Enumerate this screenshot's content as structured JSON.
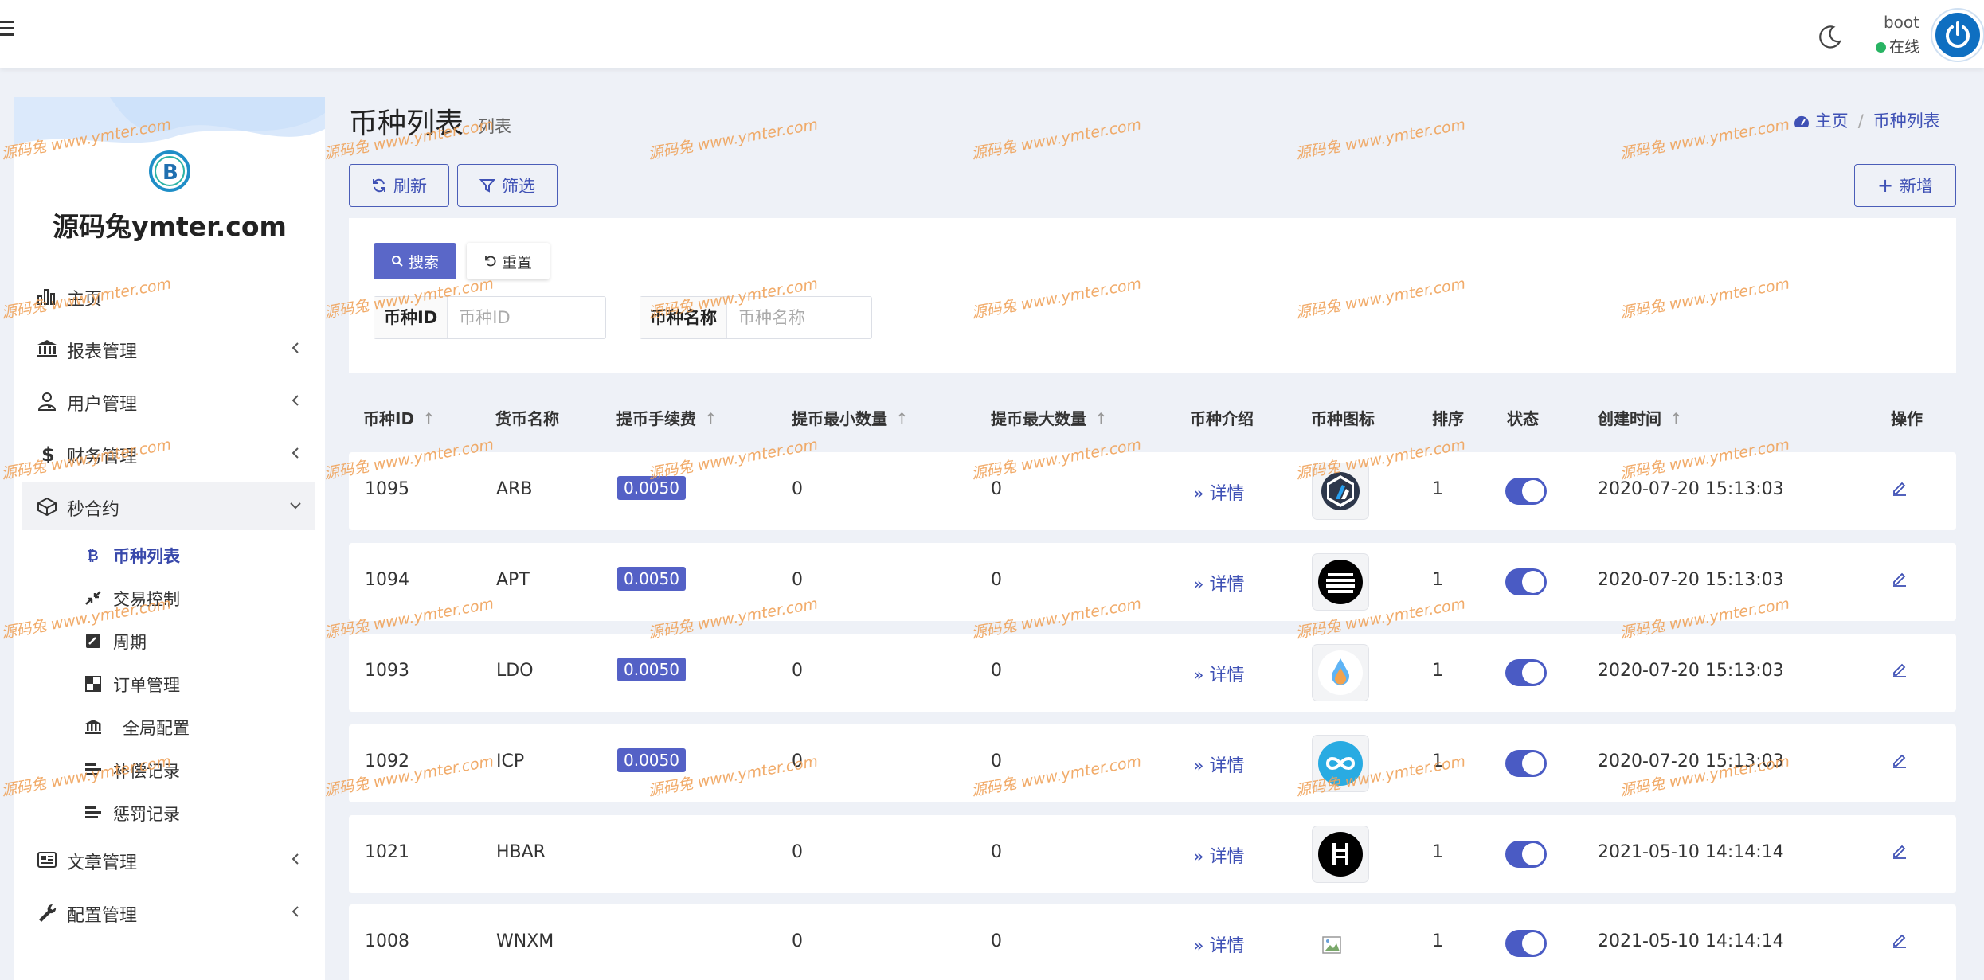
{
  "header": {
    "user_name": "boot",
    "user_status": "在线"
  },
  "sidebar": {
    "brand": "源码兔ymter.com",
    "items": [
      {
        "label": "主页",
        "icon": "bar-chart-icon"
      },
      {
        "label": "报表管理",
        "icon": "bank-icon"
      },
      {
        "label": "用户管理",
        "icon": "user-doctor-icon"
      },
      {
        "label": "财务管理",
        "icon": "dollar-icon"
      },
      {
        "label": "秒合约",
        "icon": "cube-icon"
      },
      {
        "label": "文章管理",
        "icon": "newspaper-icon"
      },
      {
        "label": "配置管理",
        "icon": "wrench-icon"
      }
    ],
    "sub_items": [
      {
        "label": "币种列表",
        "icon": "bitcoin-icon"
      },
      {
        "label": "交易控制",
        "icon": "compress-icon"
      },
      {
        "label": "周期",
        "icon": "edit-square-icon"
      },
      {
        "label": "订单管理",
        "icon": "chess-board-icon"
      },
      {
        "label": "全局配置",
        "icon": "bank-icon"
      },
      {
        "label": "补偿记录",
        "icon": "align-left-icon"
      },
      {
        "label": "惩罚记录",
        "icon": "align-left-icon"
      }
    ]
  },
  "page": {
    "title": "币种列表",
    "subtitle": "列表",
    "breadcrumb": {
      "home": "主页",
      "current": "币种列表"
    },
    "refresh_label": "刷新",
    "filter_label": "筛选",
    "add_label": "新增"
  },
  "search": {
    "search_label": "搜索",
    "reset_label": "重置",
    "id_label": "币种ID",
    "id_placeholder": "币种ID",
    "name_label": "币种名称",
    "name_placeholder": "币种名称"
  },
  "table": {
    "headers": [
      "币种ID",
      "货币名称",
      "提币手续费",
      "提币最小数量",
      "提币最大数量",
      "币种介绍",
      "币种图标",
      "排序",
      "状态",
      "创建时间",
      "操作"
    ],
    "sort_glyph": "↑",
    "detail_label": "详情",
    "rows": [
      {
        "id": "1095",
        "name": "ARB",
        "fee": "0.0050",
        "min": "0",
        "max": "0",
        "icon": "arbitrum-icon",
        "sort": "1",
        "status": true,
        "created": "2020-07-20 15:13:03"
      },
      {
        "id": "1094",
        "name": "APT",
        "fee": "0.0050",
        "min": "0",
        "max": "0",
        "icon": "aptos-icon",
        "sort": "1",
        "status": true,
        "created": "2020-07-20 15:13:03"
      },
      {
        "id": "1093",
        "name": "LDO",
        "fee": "0.0050",
        "min": "0",
        "max": "0",
        "icon": "lido-icon",
        "sort": "1",
        "status": true,
        "created": "2020-07-20 15:13:03"
      },
      {
        "id": "1092",
        "name": "ICP",
        "fee": "0.0050",
        "min": "0",
        "max": "0",
        "icon": "icp-icon",
        "sort": "1",
        "status": true,
        "created": "2020-07-20 15:13:03"
      },
      {
        "id": "1021",
        "name": "HBAR",
        "fee": "",
        "min": "0",
        "max": "0",
        "icon": "hedera-icon",
        "sort": "1",
        "status": true,
        "created": "2021-05-10 14:14:14"
      },
      {
        "id": "1008",
        "name": "WNXM",
        "fee": "",
        "min": "0",
        "max": "0",
        "icon": "broken-image-icon",
        "sort": "1",
        "status": true,
        "created": "2021-05-10 14:14:14"
      }
    ]
  },
  "watermark": "源码兔 www.ymter.com",
  "colors": {
    "primary": "#3f51b5",
    "badge": "#5461c6",
    "online": "#28b463",
    "watermark": "#f0a35a"
  }
}
